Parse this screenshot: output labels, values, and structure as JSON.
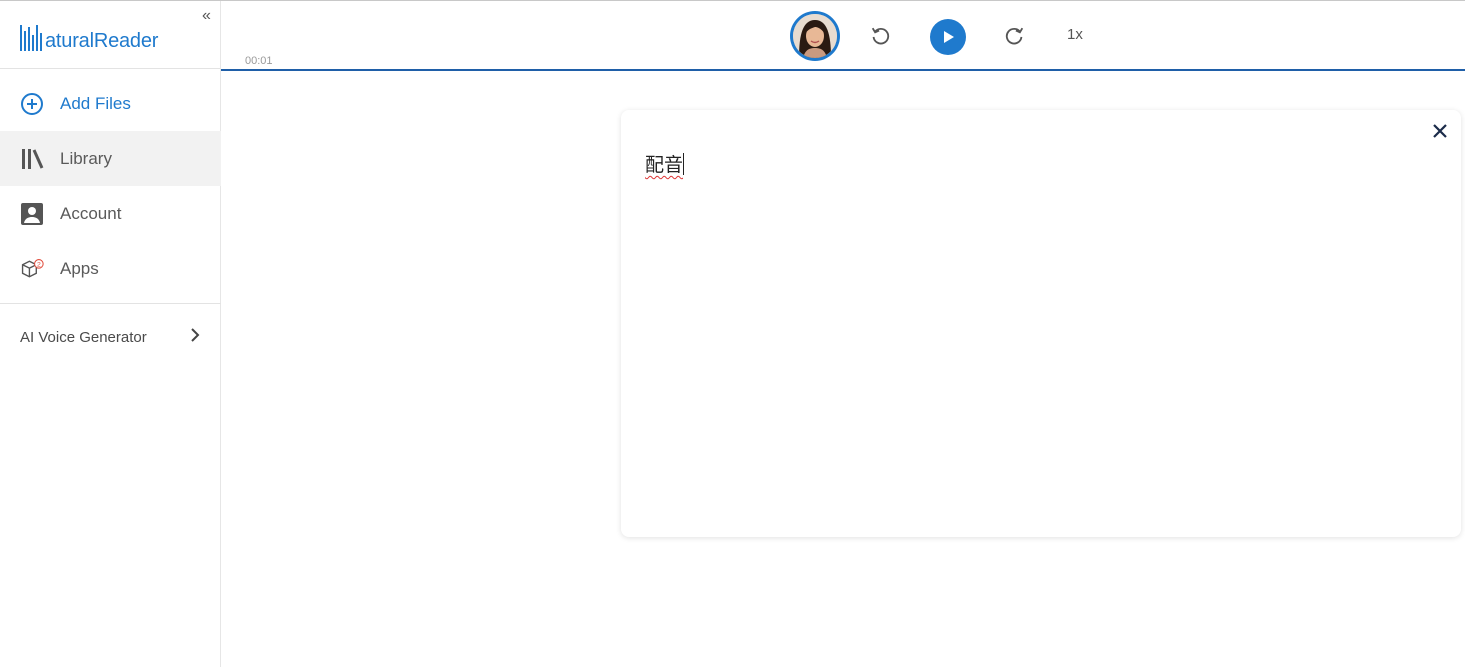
{
  "app": {
    "logo_text": "aturalReader"
  },
  "sidebar": {
    "collapse_icon": "«",
    "items": [
      {
        "label": "Add Files",
        "icon": "plus-circle-icon"
      },
      {
        "label": "Library",
        "icon": "library-icon"
      },
      {
        "label": "Account",
        "icon": "account-icon"
      },
      {
        "label": "Apps",
        "icon": "apps-box-icon",
        "badge": "2"
      }
    ],
    "ai_voice_generator": "AI Voice Generator"
  },
  "player": {
    "time": "00:01",
    "speed": "1x",
    "progress": 1.0
  },
  "editor": {
    "text": "配音"
  },
  "colors": {
    "accent": "#1f7acd",
    "progress": "#1f5fa8",
    "badge": "#e04a3a"
  }
}
